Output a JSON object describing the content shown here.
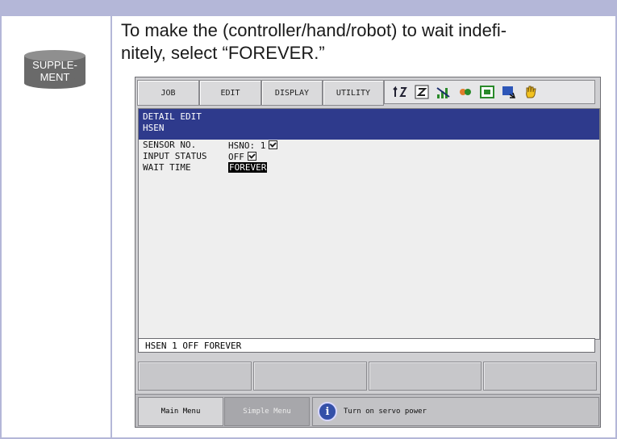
{
  "supplement": {
    "badge_line1": "SUPPLE-",
    "badge_line2": "MENT",
    "text_line1": "To make the (controller/hand/robot) to wait indefi-",
    "text_line2": "nitely, select “FOREVER.”"
  },
  "pendant": {
    "menu": {
      "job": "JOB",
      "edit": "EDIT",
      "display": "DISPLAY",
      "utility": "UTILITY"
    },
    "header": {
      "line1": "DETAIL EDIT",
      "line2": "HSEN"
    },
    "fields": [
      {
        "label": "SENSOR NO.",
        "value": "HSNO: 1"
      },
      {
        "label": "INPUT STATUS",
        "value": "OFF"
      },
      {
        "label": "WAIT TIME",
        "value": "FOREVER"
      }
    ],
    "command_line": "HSEN 1 OFF FOREVER",
    "bottom": {
      "main_menu": "Main Menu",
      "simple_menu": "Simple Menu",
      "status": "Turn on servo power"
    },
    "icons": [
      "arrows-icon",
      "z-icon",
      "signal-icon",
      "servo-icon",
      "screen-icon",
      "monitor-icon",
      "hand-icon"
    ]
  }
}
